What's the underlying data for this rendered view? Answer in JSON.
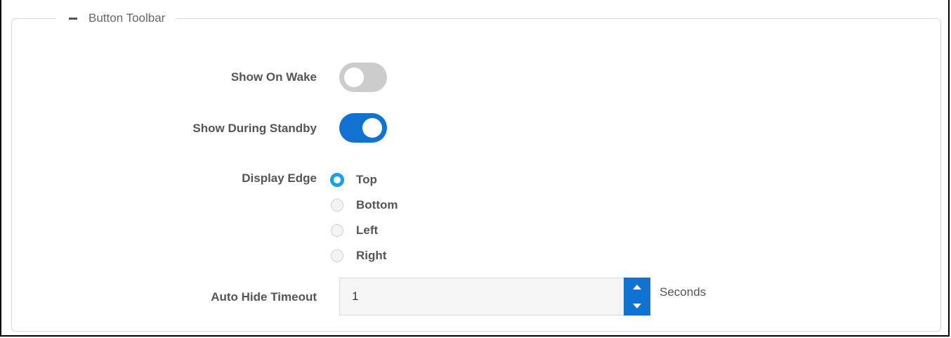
{
  "section": {
    "title": "Button Toolbar"
  },
  "show_on_wake": {
    "label": "Show On Wake",
    "enabled": false
  },
  "show_during_standby": {
    "label": "Show During Standby",
    "enabled": true
  },
  "display_edge": {
    "label": "Display Edge",
    "options": [
      "Top",
      "Bottom",
      "Left",
      "Right"
    ],
    "selected": "Top"
  },
  "auto_hide_timeout": {
    "label": "Auto Hide Timeout",
    "value": "1",
    "unit": "Seconds"
  },
  "colors": {
    "accent": "#1172d1",
    "radio_selected": "#1aa0ea",
    "toggle_off": "#cccccc"
  },
  "icons": {
    "collapse": "minus-icon",
    "increment": "chevron-up-icon",
    "decrement": "chevron-down-icon"
  }
}
